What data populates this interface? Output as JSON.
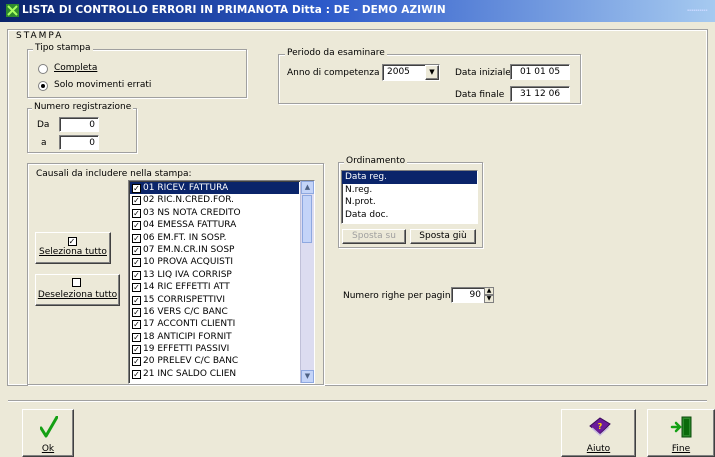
{
  "window": {
    "title": "LISTA DI CONTROLLO ERRORI IN PRIMANOTA  Ditta : DE - DEMO AZIWIN"
  },
  "stampa": {
    "label": "STAMPA",
    "tipo_stampa": {
      "label": "Tipo stampa",
      "options": [
        {
          "label": "Completa",
          "selected": false
        },
        {
          "label": "Solo movimenti errati",
          "selected": true
        }
      ]
    },
    "numero_registrazione": {
      "label": "Numero registrazione",
      "da_label": "Da",
      "da_value": "0",
      "a_label": "a",
      "a_value": "0"
    },
    "periodo": {
      "label": "Periodo da esaminare",
      "anno_label": "Anno di competenza",
      "anno_value": "2005",
      "data_iniziale_label": "Data iniziale",
      "data_iniziale": [
        "01",
        "01",
        "05"
      ],
      "data_finale_label": "Data finale",
      "data_finale": [
        "31",
        "12",
        "06"
      ]
    },
    "causali": {
      "label": "Causali da includere nella stampa:",
      "items": [
        {
          "label": "01 RICEV. FATTURA",
          "checked": true,
          "selected": true
        },
        {
          "label": "02 RIC.N.CRED.FOR.",
          "checked": true
        },
        {
          "label": "03 NS NOTA CREDITO",
          "checked": true
        },
        {
          "label": "04 EMESSA FATTURA",
          "checked": true
        },
        {
          "label": "06 EM.FT. IN SOSP.",
          "checked": true
        },
        {
          "label": "07 EM.N.CR.IN SOSP",
          "checked": true
        },
        {
          "label": "10 PROVA ACQUISTI",
          "checked": true
        },
        {
          "label": "13 LIQ IVA CORRISP",
          "checked": true
        },
        {
          "label": "14 RIC EFFETTI ATT",
          "checked": true
        },
        {
          "label": "15 CORRISPETTIVI",
          "checked": true
        },
        {
          "label": "16 VERS C/C BANC",
          "checked": true
        },
        {
          "label": "17 ACCONTI CLIENTI",
          "checked": true
        },
        {
          "label": "18 ANTICIPI FORNIT",
          "checked": true
        },
        {
          "label": "19 EFFETTI PASSIVI",
          "checked": true
        },
        {
          "label": "20 PRELEV C/C BANC",
          "checked": true
        },
        {
          "label": "21 INC SALDO CLIEN",
          "checked": true
        }
      ],
      "seleziona_label": "Seleziona tutto",
      "deseleziona_label": "Deseleziona tutto"
    },
    "ordinamento": {
      "label": "Ordinamento",
      "items": [
        "Data reg.",
        "N.reg.",
        "N.prot.",
        "Data doc."
      ],
      "selected_index": 0,
      "sposta_su": "Sposta su",
      "sposta_giu": "Sposta giù"
    },
    "righe_pagina": {
      "label": "Numero righe per pagina",
      "value": "90"
    }
  },
  "footer": {
    "ok_label": "Ok",
    "aiuto_label": "Aiuto",
    "fine_label": "Fine"
  },
  "colors": {
    "titlebar_start": "#0a246a",
    "selection": "#0a246a",
    "window_bg": "#ece9d8"
  }
}
